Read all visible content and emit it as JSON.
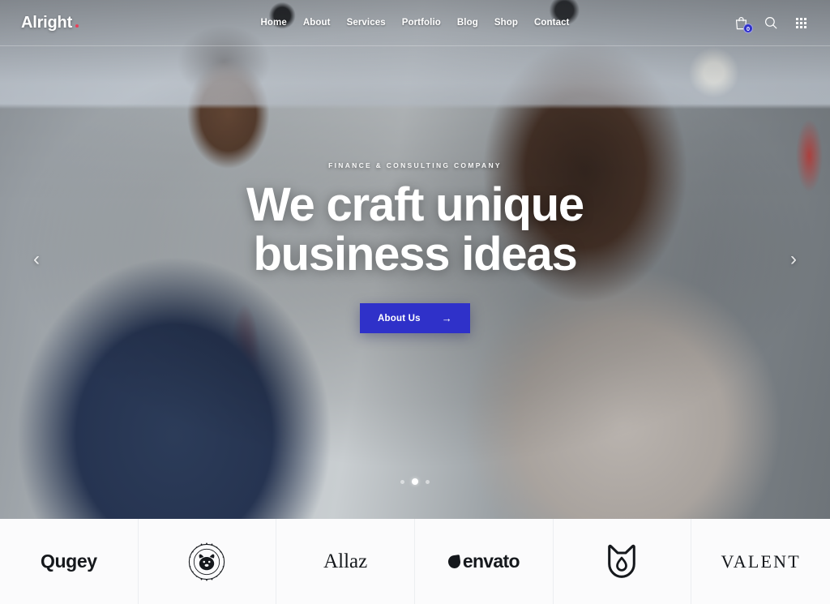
{
  "header": {
    "brand": {
      "name": "Alright",
      "dot_color": "#e8405a"
    },
    "nav": [
      {
        "label": "Home"
      },
      {
        "label": "About"
      },
      {
        "label": "Services"
      },
      {
        "label": "Portfolio"
      },
      {
        "label": "Blog"
      },
      {
        "label": "Shop"
      },
      {
        "label": "Contact"
      }
    ],
    "tools": {
      "cart_icon": "shopping-bag-icon",
      "cart_count": "0",
      "cart_badge_color": "#2f31c9",
      "search_icon": "search-icon",
      "apps_icon": "grid-menu-icon"
    }
  },
  "hero": {
    "eyebrow": "FINANCE & CONSULTING COMPANY",
    "title_line1": "We craft unique",
    "title_line2": "business ideas",
    "cta_label": "About Us",
    "cta_arrow": "→",
    "cta_color": "#2f31c9",
    "prev_arrow": "‹",
    "next_arrow": "›",
    "slides": [
      {
        "index": "1",
        "active": false
      },
      {
        "index": "2",
        "active": true
      },
      {
        "index": "3",
        "active": false
      }
    ]
  },
  "logo_strip": {
    "logos": [
      {
        "name": "Qugey",
        "type": "wordmark"
      },
      {
        "name": "Bulldog",
        "type": "badge",
        "ring_top": "BULLDOG",
        "ring_bottom": "HARD TO GO"
      },
      {
        "name": "Allaz",
        "type": "wordmark-serif"
      },
      {
        "name": "envato",
        "type": "wordmark-mark"
      },
      {
        "name": "Tulip Shield",
        "type": "mark"
      },
      {
        "name": "VALENT",
        "type": "wordmark-serif-caps"
      }
    ]
  }
}
